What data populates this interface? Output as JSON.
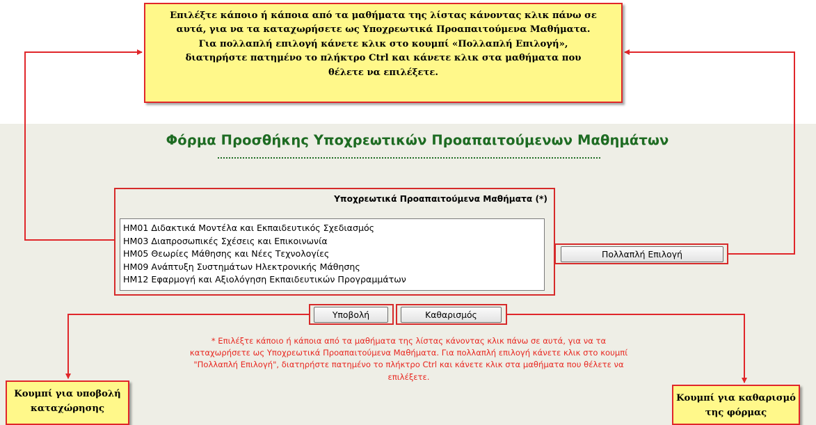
{
  "top_callout": {
    "lines": [
      "Επιλέξτε κάποιο ή κάποια από τα μαθήματα της λίστας κάνοντας κλικ πάνω σε",
      "αυτά, για να τα καταχωρήσετε ως Υποχρεωτικά Προαπαιτούμενα Μαθήματα.",
      "Για πολλαπλή επιλογή κάνετε κλικ στο κουμπί «Πολλαπλή Επιλογή»,",
      "διατηρήστε πατημένο το πλήκτρο Ctrl και κάνετε κλικ στα μαθήματα που",
      "θέλετε να επιλέξετε."
    ]
  },
  "form": {
    "title": "Φόρμα Προσθήκης Υποχρεωτικών Προαπαιτούμενων Μαθημάτων",
    "list_label": "Υποχρεωτικά Προαπαιτούμενα Μαθήματα (*)",
    "courses": [
      "HM01 Διδακτικά Μοντέλα και Εκπαιδευτικός Σχεδιασμός",
      "HM03 Διαπροσωπικές Σχέσεις και Επικοινωνία",
      "HM05 Θεωρίες Μάθησης και Νέες Τεχνολογίες",
      "HM09 Ανάπτυξη Συστημάτων Ηλεκτρονικής Μάθησης",
      "HM12 Εφαρμογή και Αξιολόγηση Εκπαιδευτικών Προγραμμάτων"
    ],
    "multi_select_label": "Πολλαπλή Επιλογή",
    "submit_label": "Υποβολή",
    "clear_label": "Καθαρισμός",
    "help_lines": [
      "* Επιλέξτε κάποιο ή κάποια από τα μαθήματα της λίστας κάνοντας κλικ πάνω σε αυτά, για να τα",
      "καταχωρήσετε ως Υποχρεωτικά Προαπαιτούμενα Μαθήματα. Για πολλαπλή επιλογή κάνετε κλικ στο κουμπί",
      "\"Πολλαπλή Επιλογή\", διατηρήστε πατημένο το πλήκτρο Ctrl και κάνετε κλικ στα μαθήματα που θέλετε να",
      "επιλέξετε."
    ]
  },
  "submit_callout": {
    "lines": [
      "Κουμπί για υποβολή",
      "καταχώρησης"
    ]
  },
  "clear_callout": {
    "lines": [
      "Κουμπί για καθαρισμό",
      "της φόρμας"
    ]
  },
  "colors": {
    "accent_red": "#e0262a",
    "title_green": "#1d6b22",
    "callout_yellow": "#fff88a",
    "panel_background": "#eeeee6"
  }
}
